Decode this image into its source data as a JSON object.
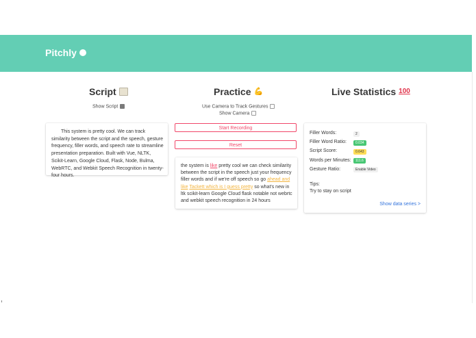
{
  "app": {
    "name": "Pitchly"
  },
  "script_col": {
    "title": "Script",
    "show_label": "Show Script",
    "text": "This system is pretty cool. We can track similarity between the script and the speech, gesture frequency, filler words, and speech rate to streamline presentation preparation. Built with Vue, NLTK, Scikit-Learn, Google Cloud, Flask, Node, Bulma, WebRTC, and Webkit Speech Recognition in twenty-four hours."
  },
  "practice_col": {
    "title": "Practice",
    "camera_track_label": "Use Camera to Track Gestures",
    "show_camera_label": "Show Camera",
    "start_label": "Start Recording",
    "reset_label": "Reset",
    "transcript": {
      "t1": "the system is ",
      "f1": "like",
      "t2": " pretty cool we can check similarity between the script in the speech just your frequency filler words and if we're off speech so go ",
      "o1": "ahead and",
      "sp": " ",
      "o2": "like",
      "sp2": " ",
      "o3": "Tackett which is I guess pretty",
      "t3": " so what's new in ltk scikit-learn Google Cloud flask notable not webrtc and webkit speech recognition in 24 hours"
    }
  },
  "stats_col": {
    "title": "Live Statistics",
    "rows": [
      {
        "label": "Filler Words:",
        "value": "2"
      },
      {
        "label": "Filler Word Ratio:",
        "value": "0.034"
      },
      {
        "label": "Script Score:",
        "value": "0.643"
      },
      {
        "label": "Words per Minutes:",
        "value": "111.6"
      },
      {
        "label": "Gesture Ratio:",
        "value": "Enable Video"
      }
    ],
    "tips_label": "Tips:",
    "tip_text": "Try to stay on script",
    "data_link": "Show data series >"
  },
  "colors": {
    "hero": "#63ceb4",
    "danger": "#f14668",
    "success": "#48c774",
    "warning": "#ffdd57",
    "link": "#3273dc"
  },
  "icons": {
    "brand": "speech-bubble-icon",
    "script": "scroll-icon",
    "practice": "flexed-biceps-icon",
    "stats": "hundred-points-icon"
  }
}
